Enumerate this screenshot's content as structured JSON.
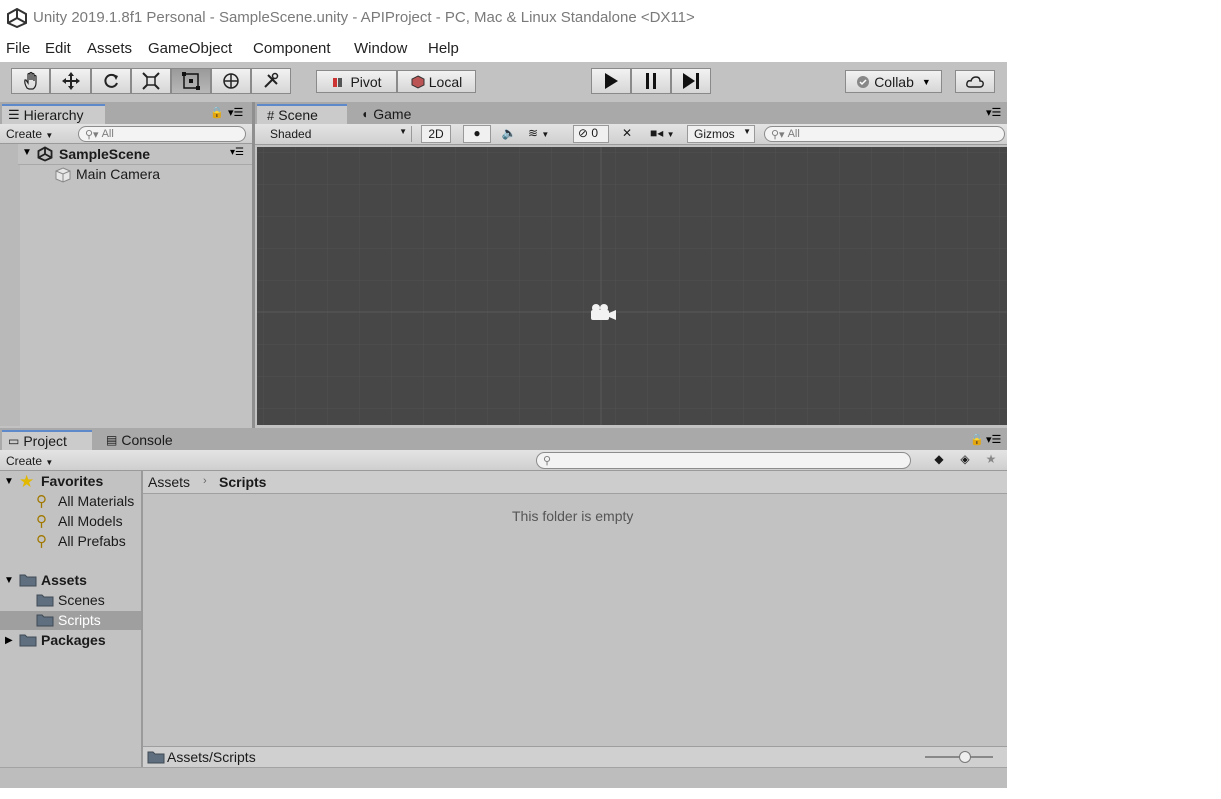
{
  "window": {
    "title": "Unity 2019.1.8f1 Personal - SampleScene.unity - APIProject - PC, Mac & Linux Standalone <DX11>"
  },
  "menu": [
    "File",
    "Edit",
    "Assets",
    "GameObject",
    "Component",
    "Window",
    "Help"
  ],
  "toolbar": {
    "pivot_label": "Pivot",
    "local_label": "Local",
    "collab_label": "Collab"
  },
  "hierarchy": {
    "tab_label": "Hierarchy",
    "create_label": "Create",
    "search_placeholder": "All",
    "scene_name": "SampleScene",
    "items": [
      "Main Camera"
    ]
  },
  "scene_view": {
    "tab_scene": "Scene",
    "tab_game": "Game",
    "shading_mode": "Shaded",
    "mode_2d": "2D",
    "hidden_count": "0",
    "gizmos_label": "Gizmos",
    "search_placeholder": "All"
  },
  "project": {
    "tab_project": "Project",
    "tab_console": "Console",
    "create_label": "Create",
    "favorites_label": "Favorites",
    "favorites": [
      "All Materials",
      "All Models",
      "All Prefabs"
    ],
    "assets_label": "Assets",
    "asset_folders": [
      "Scenes",
      "Scripts"
    ],
    "packages_label": "Packages",
    "breadcrumb": [
      "Assets",
      "Scripts"
    ],
    "empty_message": "This folder is empty",
    "footer_path": "Assets/Scripts"
  },
  "colors": {
    "editor_bg": "#c2c2c2",
    "scene_bg": "#474747",
    "selection": "#9f9f9f",
    "tab_accent": "#5d88c9"
  }
}
